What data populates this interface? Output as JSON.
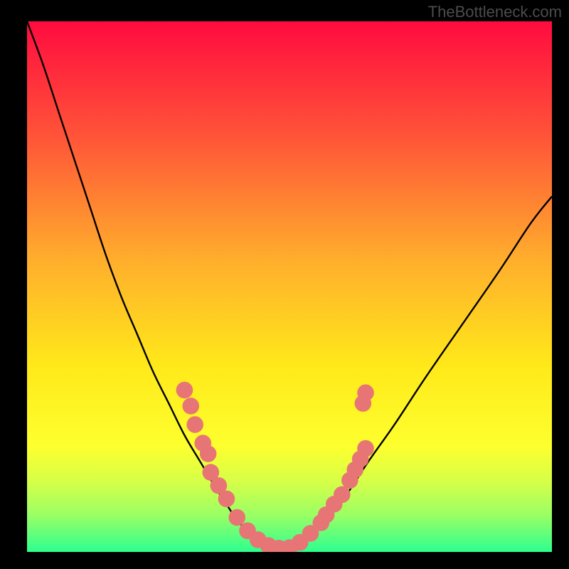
{
  "watermark": "TheBottleneck.com",
  "chart_data": {
    "type": "line",
    "title": "",
    "xlabel": "",
    "ylabel": "",
    "xlim": [
      0,
      100
    ],
    "ylim": [
      0,
      100
    ],
    "background": {
      "type": "vertical-gradient",
      "stops": [
        {
          "offset": 0,
          "color": "#ff0b3f"
        },
        {
          "offset": 22,
          "color": "#ff5538"
        },
        {
          "offset": 45,
          "color": "#ffae2c"
        },
        {
          "offset": 65,
          "color": "#ffe91a"
        },
        {
          "offset": 80,
          "color": "#feff2e"
        },
        {
          "offset": 87,
          "color": "#d4ff49"
        },
        {
          "offset": 93,
          "color": "#9bff64"
        },
        {
          "offset": 100,
          "color": "#2dff90"
        }
      ]
    },
    "series": [
      {
        "name": "bottleneck-curve",
        "color": "#000000",
        "x": [
          0,
          3,
          6,
          9,
          12,
          15,
          18,
          21,
          24,
          27,
          30,
          33,
          36,
          38,
          40,
          42,
          44,
          46,
          48,
          50,
          52,
          54,
          56,
          58,
          61,
          65,
          70,
          76,
          83,
          90,
          96,
          100
        ],
        "y": [
          100,
          92,
          83,
          74,
          65,
          56,
          48,
          41,
          34,
          28,
          22,
          17,
          12,
          9,
          6,
          4,
          2,
          1,
          0.5,
          0.8,
          1.8,
          3.2,
          5,
          7.5,
          11,
          17,
          24,
          33,
          43,
          53,
          62,
          67
        ]
      }
    ],
    "markers": {
      "name": "sample-points",
      "color": "#e87575",
      "radius": 1.6,
      "points": [
        {
          "x": 30.0,
          "y": 30.5
        },
        {
          "x": 31.2,
          "y": 27.5
        },
        {
          "x": 32.0,
          "y": 24.0
        },
        {
          "x": 33.5,
          "y": 20.5
        },
        {
          "x": 34.5,
          "y": 18.5
        },
        {
          "x": 35.0,
          "y": 15.0
        },
        {
          "x": 36.5,
          "y": 12.5
        },
        {
          "x": 38.0,
          "y": 10.0
        },
        {
          "x": 40.0,
          "y": 6.5
        },
        {
          "x": 42.0,
          "y": 4.0
        },
        {
          "x": 44.0,
          "y": 2.3
        },
        {
          "x": 46.0,
          "y": 1.2
        },
        {
          "x": 48.0,
          "y": 0.7
        },
        {
          "x": 50.0,
          "y": 0.8
        },
        {
          "x": 52.0,
          "y": 1.8
        },
        {
          "x": 54.0,
          "y": 3.5
        },
        {
          "x": 56.0,
          "y": 5.5
        },
        {
          "x": 57.0,
          "y": 7.0
        },
        {
          "x": 58.5,
          "y": 9.0
        },
        {
          "x": 60.0,
          "y": 10.8
        },
        {
          "x": 61.5,
          "y": 13.5
        },
        {
          "x": 62.5,
          "y": 15.5
        },
        {
          "x": 63.5,
          "y": 17.5
        },
        {
          "x": 64.5,
          "y": 19.5
        },
        {
          "x": 64.0,
          "y": 28.0
        },
        {
          "x": 64.5,
          "y": 30.0
        }
      ]
    }
  }
}
